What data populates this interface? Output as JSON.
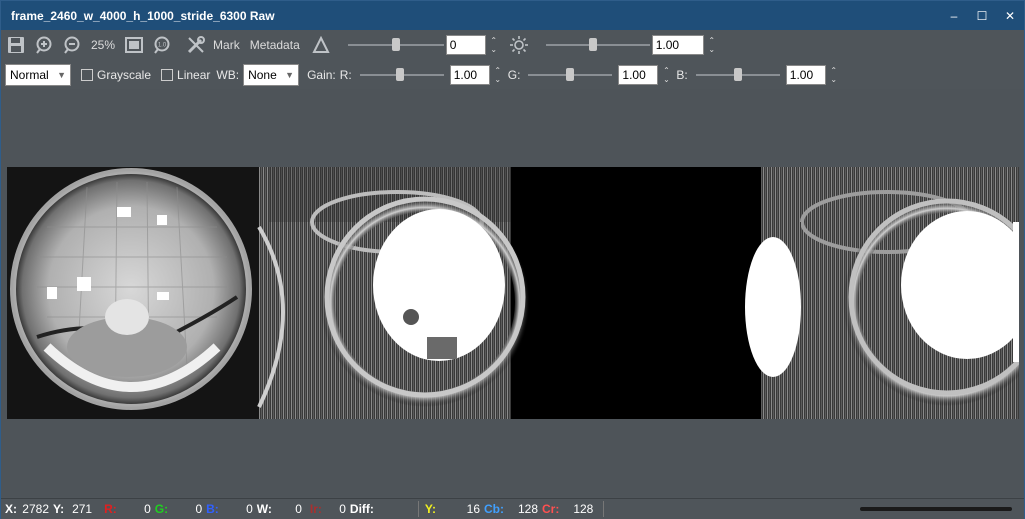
{
  "window": {
    "title": "frame_2460_w_4000_h_1000_stride_6300 Raw",
    "minimize": "–",
    "maximize": "☐",
    "close": "✕"
  },
  "toolbar": {
    "zoom": "25%",
    "mark": "Mark",
    "metadata": "Metadata",
    "exposure_value": "0",
    "brightness_value": "1.00",
    "exposure_slider_fraction": 0.5,
    "brightness_slider_fraction": 0.45
  },
  "toolbar2": {
    "mode": "Normal",
    "grayscale": "Grayscale",
    "linear": "Linear",
    "wb_label": "WB:",
    "wb_value": "None",
    "gain_label": "Gain:",
    "r_label": "R:",
    "r_value": "1.00",
    "g_label": "G:",
    "g_value": "1.00",
    "b_label": "B:",
    "b_value": "1.00",
    "grayscale_checked": false,
    "linear_checked": false
  },
  "status": {
    "x_label": "X:",
    "x": "2782",
    "y_label": "Y:",
    "y": "271",
    "r_label": "R:",
    "r": "0",
    "g_label": "G:",
    "g": "0",
    "b_label": "B:",
    "b": "0",
    "w_label": "W:",
    "w": "0",
    "ir_label": "Ir:",
    "ir": "0",
    "diff_label": "Diff:",
    "yy_label": "Y:",
    "yy": "16",
    "cb_label": "Cb:",
    "cb": "128",
    "cr_label": "Cr:",
    "cr": "128"
  },
  "colors": {
    "titlebar": "#1f4e79",
    "r": "#e02020",
    "g": "#20d020",
    "b": "#3060ff",
    "ir": "#a83030",
    "yy": "#f0f020",
    "cb": "#40a0ff",
    "cr": "#ff5050"
  }
}
